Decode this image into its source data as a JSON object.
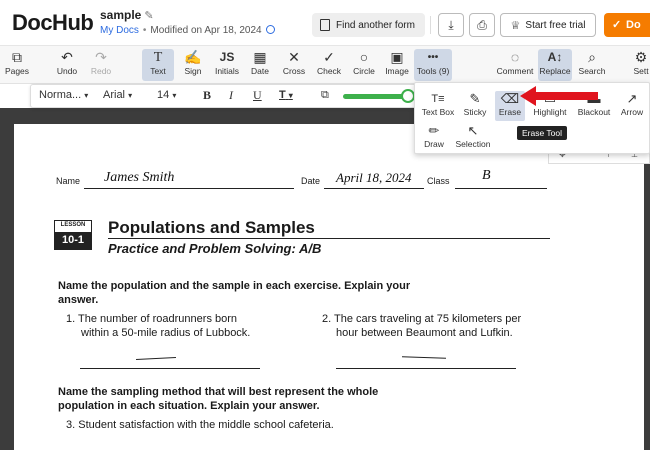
{
  "header": {
    "logo": "DocHub",
    "doc_name": "sample",
    "folder": "My Docs",
    "modified": "Modified on Apr 18, 2024",
    "find_form": "Find another form",
    "start_trial": "Start free trial",
    "done_label": "Do"
  },
  "toolbar": {
    "items": [
      {
        "label": "Pages",
        "icon": "pages-icon",
        "glyph": "⧉"
      },
      {
        "label": "Undo",
        "icon": "undo-icon",
        "glyph": "↶"
      },
      {
        "label": "Redo",
        "icon": "redo-icon",
        "glyph": "↷"
      },
      {
        "label": "Text",
        "icon": "text-icon",
        "glyph": "T"
      },
      {
        "label": "Sign",
        "icon": "sign-icon",
        "glyph": "✍"
      },
      {
        "label": "Initials",
        "icon": "initials-icon",
        "glyph": "JS"
      },
      {
        "label": "Date",
        "icon": "date-icon",
        "glyph": "▦"
      },
      {
        "label": "Cross",
        "icon": "cross-icon",
        "glyph": "✕"
      },
      {
        "label": "Check",
        "icon": "check-icon",
        "glyph": "✓"
      },
      {
        "label": "Circle",
        "icon": "circle-icon",
        "glyph": "○"
      },
      {
        "label": "Image",
        "icon": "image-icon",
        "glyph": "▣"
      },
      {
        "label": "Tools (9)",
        "icon": "more-icon",
        "glyph": "•••"
      },
      {
        "label": "Comment",
        "icon": "comment-icon",
        "glyph": "◌"
      },
      {
        "label": "Replace",
        "icon": "replace-icon",
        "glyph": "A↕"
      },
      {
        "label": "Search",
        "icon": "search-icon",
        "glyph": "⌕"
      },
      {
        "label": "Sett",
        "icon": "settings-icon",
        "glyph": "⚙"
      }
    ]
  },
  "format_bar": {
    "style": "Norma...",
    "font": "Arial",
    "size": "14",
    "bold": "B",
    "italic": "I",
    "underline": "U",
    "text_color": "T",
    "page_label": "#1"
  },
  "tools_menu": {
    "items": [
      {
        "label": "Text Box",
        "glyph": "T≡"
      },
      {
        "label": "Sticky",
        "glyph": "✎"
      },
      {
        "label": "Erase",
        "glyph": "⌫"
      },
      {
        "label": "Highlight",
        "glyph": "▭"
      },
      {
        "label": "Blackout",
        "glyph": "▬"
      },
      {
        "label": "Arrow",
        "glyph": "↗"
      },
      {
        "label": "Draw",
        "glyph": "✏"
      },
      {
        "label": "Selection",
        "glyph": "↖"
      }
    ],
    "tooltip": "Erase Tool"
  },
  "document": {
    "name_label": "Name",
    "name_value": "James Smith",
    "date_label": "Date",
    "date_value": "April 18, 2024",
    "class_label": "Class",
    "class_value": "B",
    "lesson_label": "LESSON",
    "lesson_number": "10-1",
    "title": "Populations and Samples",
    "subtitle": "Practice and Problem Solving: A/B",
    "instruction_1a": "Name the population and the sample in each exercise. Explain your",
    "instruction_1b": "answer.",
    "q1a": "1.  The number of roadrunners born",
    "q1b": "within a 50-mile radius of Lubbock.",
    "q2a": "2.  The cars traveling at 75 kilometers per",
    "q2b": "hour between Beaumont and Lufkin.",
    "instruction_2a": "Name the sampling method that will best represent the whole",
    "instruction_2b": "population in each situation. Explain your answer.",
    "q3": "3.  Student satisfaction with the middle school cafeteria."
  },
  "colors": {
    "accent": "#f57c00",
    "link": "#2d6ce0",
    "slider": "#3db04b",
    "arrow": "#e0141e"
  }
}
